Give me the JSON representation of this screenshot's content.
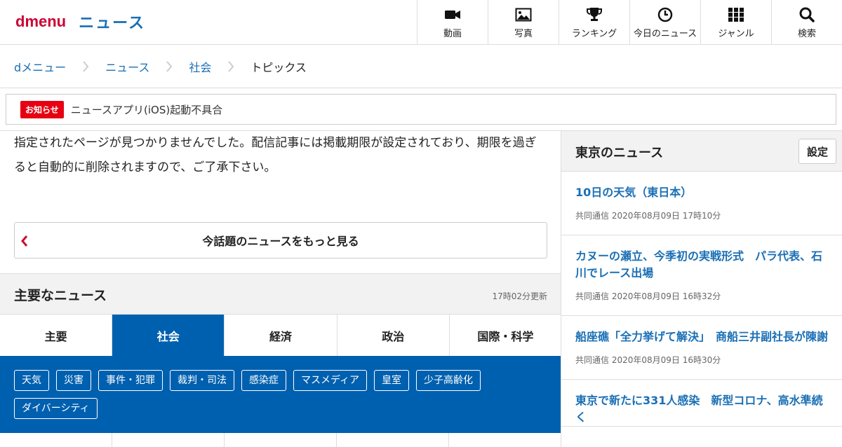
{
  "header": {
    "logo_d": "dmenu",
    "logo_news": "ニュース",
    "nav": [
      {
        "label": "動画",
        "icon": "video-camera-icon"
      },
      {
        "label": "写真",
        "icon": "photo-icon"
      },
      {
        "label": "ランキング",
        "icon": "trophy-icon"
      },
      {
        "label": "今日のニュース",
        "icon": "clock-icon"
      },
      {
        "label": "ジャンル",
        "icon": "grid-icon"
      },
      {
        "label": "検索",
        "icon": "search-icon"
      }
    ]
  },
  "breadcrumb": [
    "dメニュー",
    "ニュース",
    "社会",
    "トピックス"
  ],
  "notice": {
    "badge": "お知らせ",
    "text": "ニュースアプリ(iOS)起動不具合",
    "badge_color": "#e60012"
  },
  "main": {
    "message": "指定されたページが見つかりませんでした。配信記事には掲載期限が設定されており、期限を過ぎると自動的に削除されますので、ご了承下さい。",
    "more_button": "今話題のニュースをもっと見る",
    "major_title": "主要なニュース",
    "updated": "17時02分更新",
    "tabs": [
      {
        "label": "主要",
        "active": false
      },
      {
        "label": "社会",
        "active": true
      },
      {
        "label": "経済",
        "active": false
      },
      {
        "label": "政治",
        "active": false
      },
      {
        "label": "国際・科学",
        "active": false
      }
    ],
    "tags": [
      "天気",
      "災害",
      "事件・犯罪",
      "裁判・司法",
      "感染症",
      "マスメディア",
      "皇室",
      "少子高齢化",
      "ダイバーシティ"
    ],
    "accent_color": "#0060b0"
  },
  "sidebar": {
    "title": "東京のニュース",
    "settings_button": "設定",
    "items": [
      {
        "title": "10日の天気（東日本）",
        "meta": "共同通信 2020年08月09日 17時10分"
      },
      {
        "title": "カヌーの瀬立、今季初の実戦形式　パラ代表、石川でレース出場",
        "meta": "共同通信 2020年08月09日 16時32分"
      },
      {
        "title": "船座礁「全力挙げて解決」　商船三井副社長が陳謝",
        "meta": "共同通信 2020年08月09日 16時30分"
      },
      {
        "title": "東京で新たに331人感染　新型コロナ、高水準続く",
        "meta": ""
      }
    ],
    "link_color": "#1a6fb5"
  }
}
